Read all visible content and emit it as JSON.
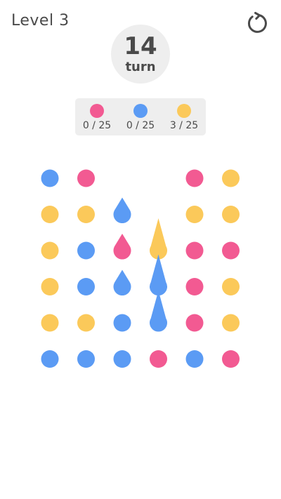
{
  "header": {
    "level_label": "Level 3",
    "restart_icon": "restart-icon"
  },
  "turn": {
    "count": "14",
    "label": "turn"
  },
  "goals": [
    {
      "color_name": "pink",
      "color": "#f25a92",
      "progress_text": "0 / 25"
    },
    {
      "color_name": "blue",
      "color": "#5b9bf4",
      "progress_text": "0 / 25"
    },
    {
      "color_name": "yellow",
      "color": "#fbc95a",
      "progress_text": "3 / 25"
    }
  ],
  "colors": {
    "pink": "#f25a92",
    "blue": "#5b9bf4",
    "yellow": "#fbc95a",
    "text": "#4a4a4a",
    "panel": "#eeeeee"
  },
  "board": {
    "rows": 6,
    "cols": 6,
    "cells": [
      [
        "blue",
        "pink",
        "",
        "",
        "pink",
        "yellow"
      ],
      [
        "yellow",
        "yellow",
        "blue-drop",
        "",
        "yellow",
        "yellow"
      ],
      [
        "yellow",
        "blue",
        "pink-drop",
        "yellow-spike",
        "pink",
        "pink"
      ],
      [
        "yellow",
        "blue",
        "blue-drop",
        "blue-spike",
        "pink",
        "yellow"
      ],
      [
        "yellow",
        "yellow",
        "blue",
        "blue-spike",
        "pink",
        "yellow"
      ],
      [
        "blue",
        "blue",
        "blue",
        "pink",
        "blue",
        "pink"
      ]
    ]
  }
}
